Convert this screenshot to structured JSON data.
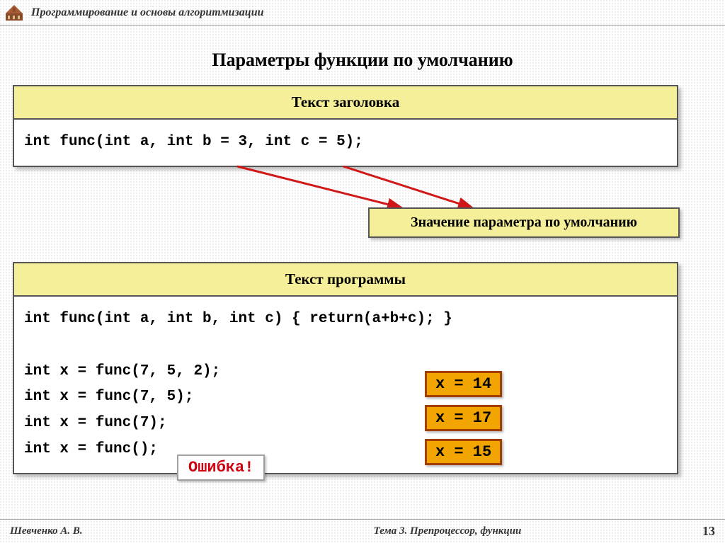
{
  "header": {
    "course_title": "Программирование и основы алгоритмизации"
  },
  "slide_title": "Параметры функции по умолчанию",
  "panel_header": {
    "title": "Текст заголовка",
    "code": "int func(int a, int b = 3, int c = 5);"
  },
  "callout_default": "Значение параметра по умолчанию",
  "panel_program": {
    "title": "Текст программы",
    "code": "int func(int a, int b, int c) { return(a+b+c); }\n\nint x = func(7, 5, 2);\nint x = func(7, 5);\nint x = func(7);\nint x = func();"
  },
  "results": {
    "r1": "x = 14",
    "r2": "x = 17",
    "r3": "x = 15"
  },
  "error_text": "Ошибка!",
  "footer": {
    "author": "Шевченко А. В.",
    "topic": "Тема 3. Препроцессор, функции",
    "page": "13"
  }
}
